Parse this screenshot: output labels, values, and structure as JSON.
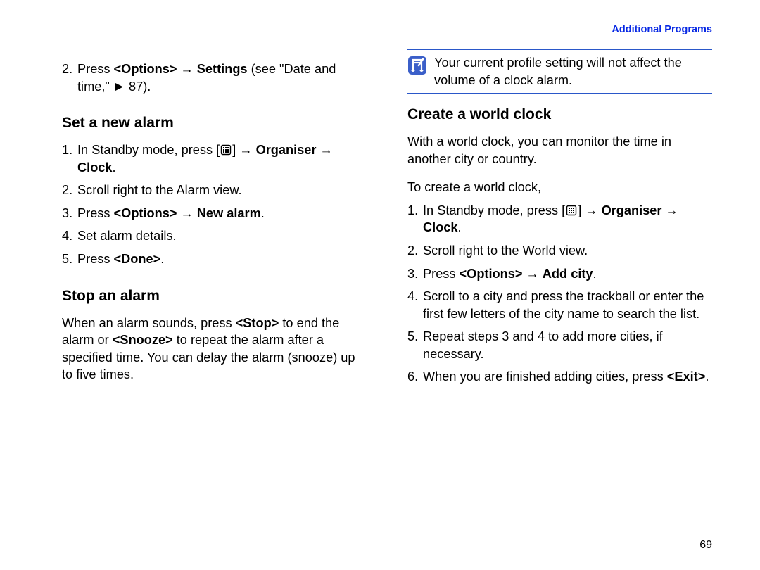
{
  "header": {
    "section": "Additional Programs"
  },
  "page_number": "69",
  "left": {
    "intro_step": {
      "num": "2.",
      "pre": "Press ",
      "b1": "<Options>",
      "arrow": " → ",
      "b2": "Settings",
      "post1": " (see \"Date and time,\" ",
      "post2": " 87)."
    },
    "h1": "Set a new alarm",
    "set_alarm": {
      "s1": {
        "num": "1.",
        "pre": "In Standby mode, press [",
        "post": "] → ",
        "b": "Organiser → Clock",
        "tail": "."
      },
      "s2": {
        "num": "2.",
        "text": "Scroll right to the Alarm view."
      },
      "s3": {
        "num": "3.",
        "pre": "Press ",
        "b1": "<Options>",
        "arrow": " → ",
        "b2": "New alarm",
        "tail": "."
      },
      "s4": {
        "num": "4.",
        "text": "Set alarm details."
      },
      "s5": {
        "num": "5.",
        "pre": "Press ",
        "b": "<Done>",
        "tail": "."
      }
    },
    "h2": "Stop an alarm",
    "stop": {
      "p1": "When an alarm sounds, press ",
      "b1": "<Stop>",
      "p2": " to end the alarm or ",
      "b2": "<Snooze>",
      "p3": " to repeat the alarm after a specified time. You can delay the alarm (snooze) up to five times."
    }
  },
  "right": {
    "note": "Your current profile setting will not affect the volume of a clock alarm.",
    "h1": "Create a world clock",
    "intro": "With a world clock, you can monitor the time in another city or country.",
    "lead": "To create a world clock,",
    "wc": {
      "s1": {
        "num": "1.",
        "pre": "In Standby mode, press [",
        "post": "] → ",
        "b": "Organiser → Clock",
        "tail": "."
      },
      "s2": {
        "num": "2.",
        "text": "Scroll right to the World view."
      },
      "s3": {
        "num": "3.",
        "pre": "Press ",
        "b1": "<Options>",
        "arrow": " → ",
        "b2": "Add city",
        "tail": "."
      },
      "s4": {
        "num": "4.",
        "text": "Scroll to a city and press the trackball or enter the first few letters of the city name to search the list."
      },
      "s5": {
        "num": "5.",
        "text": "Repeat steps 3 and 4 to add more cities, if necessary."
      },
      "s6": {
        "num": "6.",
        "pre": "When you are finished adding cities, press ",
        "b": "<Exit>",
        "tail": "."
      }
    }
  }
}
